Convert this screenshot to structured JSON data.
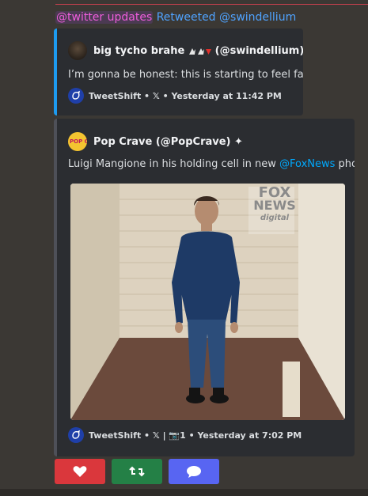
{
  "header": {
    "mention": "@twitter updates",
    "retweet_text": "Retweeted @swindellium"
  },
  "quoted_tweet": {
    "author": "big tycho brahe",
    "author_handle": "(@swindellium)",
    "text": "I’m gonna be honest: this is starting to feel fake.",
    "footer": "TweetShift • 𝕏 • Yesterday at 11:42 PM",
    "accent_color": "#1d9bf0"
  },
  "main_tweet": {
    "author": "Pop Crave (@PopCrave)",
    "avatar_text": "POP CRAVE",
    "text_before": "Luigi Mangione in his holding cell in new ",
    "link": "@FoxNews",
    "text_after": " photo.",
    "photo_watermark_1": "FOX",
    "photo_watermark_2": "NEWS",
    "photo_watermark_3": "digital",
    "footer": "TweetShift • 𝕏 | 📷1 • Yesterday at 7:02 PM"
  },
  "actions": {
    "like_color": "#da373c",
    "retweet_color": "#248046",
    "reply_color": "#5865f2"
  }
}
